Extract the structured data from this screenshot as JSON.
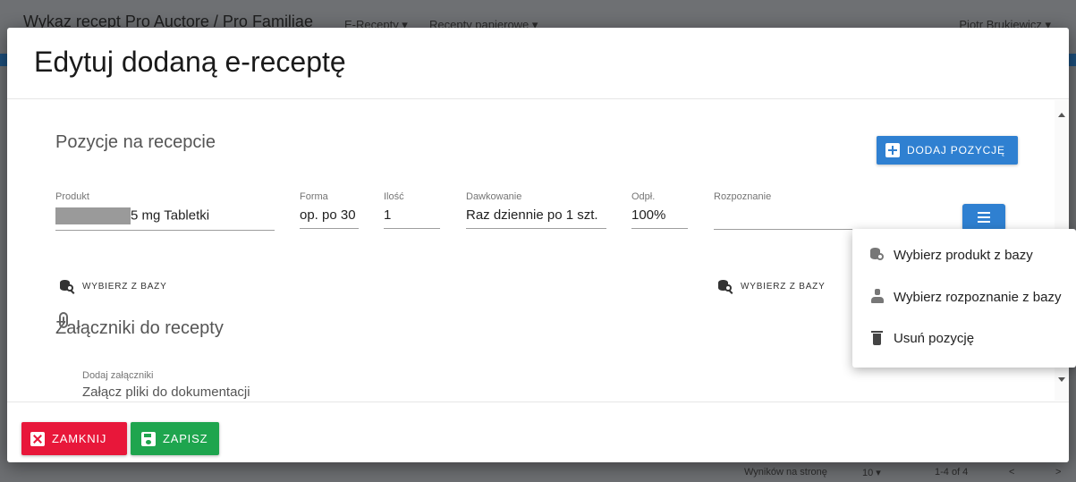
{
  "background": {
    "title": "Wykaz recept Pro Auctore / Pro Familiae",
    "menu_erecepty": "E-Recepty ▾",
    "menu_papierowe": "Recepty papierowe ▾",
    "user": "Piotr Brukiewicz ▾",
    "footer": {
      "per_page_label": "Wyników na stronę",
      "per_page_value": "10 ▾",
      "range": "1-4 of 4",
      "prev": "<",
      "next": ">"
    }
  },
  "modal": {
    "title": "Edytuj dodaną e-receptę",
    "positions_title": "Pozycje na recepcie",
    "add_button": "DODAJ POZYCJĘ",
    "fields": {
      "product": {
        "label": "Produkt",
        "value": "5 mg Tabletki"
      },
      "form": {
        "label": "Forma",
        "value": "op. po 30"
      },
      "quantity": {
        "label": "Ilość",
        "value": "1"
      },
      "dosage": {
        "label": "Dawkowanie",
        "value": "Raz dziennie po 1 szt."
      },
      "refund": {
        "label": "Odpł.",
        "value": "100%"
      },
      "diagnosis": {
        "label": "Rozpoznanie",
        "value": ""
      }
    },
    "pick_product_db": "WYBIERZ Z BAZY",
    "pick_diagnosis_db": "WYBIERZ Z BAZY",
    "attachments_title": "Załączniki do recepty",
    "attachments_label": "Dodaj załączniki",
    "attachments_placeholder": "Załącz pliki do dokumentacji",
    "close_button": "ZAMKNIJ",
    "save_button": "ZAPISZ"
  },
  "dropdown": {
    "items": [
      {
        "label": "Wybierz produkt z bazy",
        "icon": "database-search-icon"
      },
      {
        "label": "Wybierz rozpoznanie z bazy",
        "icon": "doctor-icon"
      },
      {
        "label": "Usuń pozycję",
        "icon": "trash-icon"
      }
    ]
  },
  "colors": {
    "primary": "#2f80d1",
    "danger": "#e8173a",
    "success": "#1ea54e"
  }
}
